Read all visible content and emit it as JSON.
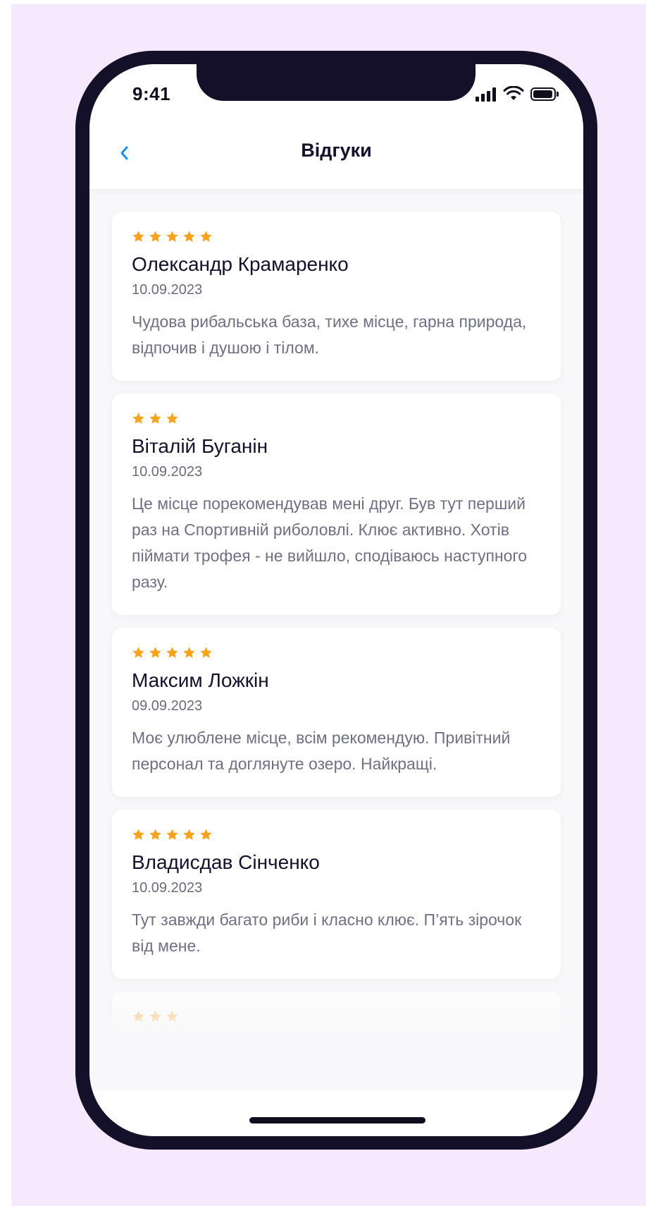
{
  "status_bar": {
    "time": "9:41"
  },
  "header": {
    "title": "Відгуки"
  },
  "colors": {
    "accent": "#1A8CF0",
    "star": "#F6A21E",
    "background": "#F6E9FE",
    "phone_frame": "#14102A"
  },
  "reviews": [
    {
      "rating": 5,
      "author": "Олександр Крамаренко",
      "date": "10.09.2023",
      "text": "Чудова рибальська база, тихе місце, гарна природа, відпочив і душою і тілом."
    },
    {
      "rating": 3,
      "author": "Віталій Буганін",
      "date": "10.09.2023",
      "text": "Це місце порекомендував мені друг. Був тут перший раз на Спортивній риболовлі. Клює активно. Хотів піймати трофея - не вийшло, сподіваюсь наступного разу."
    },
    {
      "rating": 5,
      "author": "Максим Ложкін",
      "date": "09.09.2023",
      "text": "Моє улюблене місце, всім рекомендую. Привітний персонал та доглянуте озеро. Найкращі."
    },
    {
      "rating": 5,
      "author": "Владисдав Сінченко",
      "date": "10.09.2023",
      "text": "Тут завжди багато риби і класно клює. П’ять зірочок від мене."
    },
    {
      "rating": 3,
      "author": "",
      "date": "",
      "text": ""
    }
  ],
  "icons": {
    "back": "chevron-left-icon",
    "signal": "signal-bars-icon",
    "wifi": "wifi-icon",
    "battery": "battery-icon",
    "star": "star-icon"
  }
}
